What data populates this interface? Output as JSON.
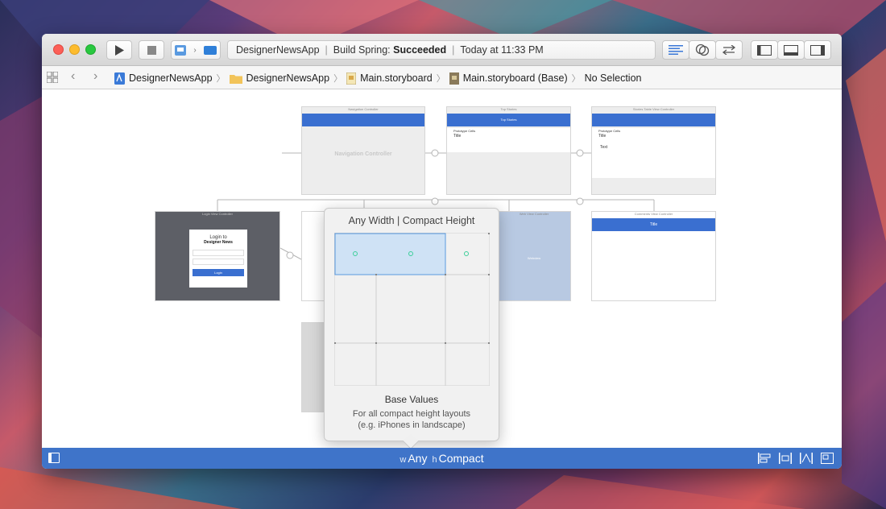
{
  "toolbar": {
    "scheme_app": "DesignerNewsApp",
    "status_build_prefix": "Build Spring:",
    "status_build_result": "Succeeded",
    "status_time": "Today at 11:33 PM"
  },
  "breadcrumb": {
    "items": [
      "DesignerNewsApp",
      "DesignerNewsApp",
      "Main.storyboard",
      "Main.storyboard (Base)",
      "No Selection"
    ]
  },
  "scenes": {
    "nav_controller_title": "Navigation Controller",
    "nav_controller_label": "Navigation Controller",
    "top_stories_title": "Top Stories",
    "top_stories_bar": "Top Stories",
    "detail_title": "Stories Table View Controller",
    "login_title": "Login View Controller",
    "login_heading": "Login to",
    "login_subheading": "Designer News",
    "login_button": "Login",
    "web_title": "Web View Controller",
    "web_label": "Webview",
    "comments_title": "Comments View Controller",
    "comments_bar": "Title",
    "prototype_cells": "Prototype Cells",
    "cell_title": "Title",
    "cell_text": "Text"
  },
  "popover": {
    "title": "Any Width | Compact Height",
    "base_values": "Base Values",
    "desc_line1": "For all compact height layouts",
    "desc_line2": "(e.g. iPhones in landscape)"
  },
  "bottombar": {
    "w_prefix": "w",
    "w_value": "Any",
    "h_prefix": "h",
    "h_value": "Compact"
  },
  "colors": {
    "accent": "#3f74c9",
    "nav_blue": "#3a6fd0",
    "selection": "#cfe2f5"
  }
}
